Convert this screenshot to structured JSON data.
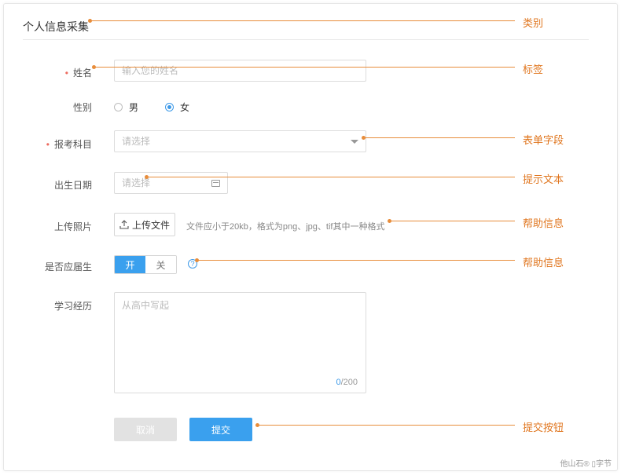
{
  "section": {
    "title": "个人信息采集"
  },
  "form": {
    "name": {
      "label": "姓名",
      "required_mark": "•",
      "placeholder": "输入您的姓名"
    },
    "gender": {
      "label": "性别",
      "options": [
        "男",
        "女"
      ],
      "selected": "女"
    },
    "subject": {
      "label": "报考科目",
      "required_mark": "•",
      "placeholder": "请选择"
    },
    "birthday": {
      "label": "出生日期",
      "placeholder": "请选择"
    },
    "photo": {
      "label": "上传照片",
      "button": "上传文件",
      "help": "文件应小于20kb，格式为png、jpg、tif其中一种格式"
    },
    "graduate": {
      "label": "是否应届生",
      "on": "开",
      "off": "关",
      "help_icon": "?"
    },
    "study": {
      "label": "学习经历",
      "placeholder": "从高中写起",
      "count": "0",
      "max": "/200"
    },
    "actions": {
      "cancel": "取消",
      "submit": "提交"
    }
  },
  "annotations": {
    "category": "类别",
    "tag": "标签",
    "form_field": "表单字段",
    "hint_text": "提示文本",
    "help_info_1": "帮助信息",
    "help_info_2": "帮助信息",
    "submit_button": "提交按钮"
  },
  "watermark": "他山石® ▯字节",
  "colors": {
    "accent": "#3aa0ee",
    "annotation": "#e88d3b",
    "required": "#ed6b5f"
  }
}
